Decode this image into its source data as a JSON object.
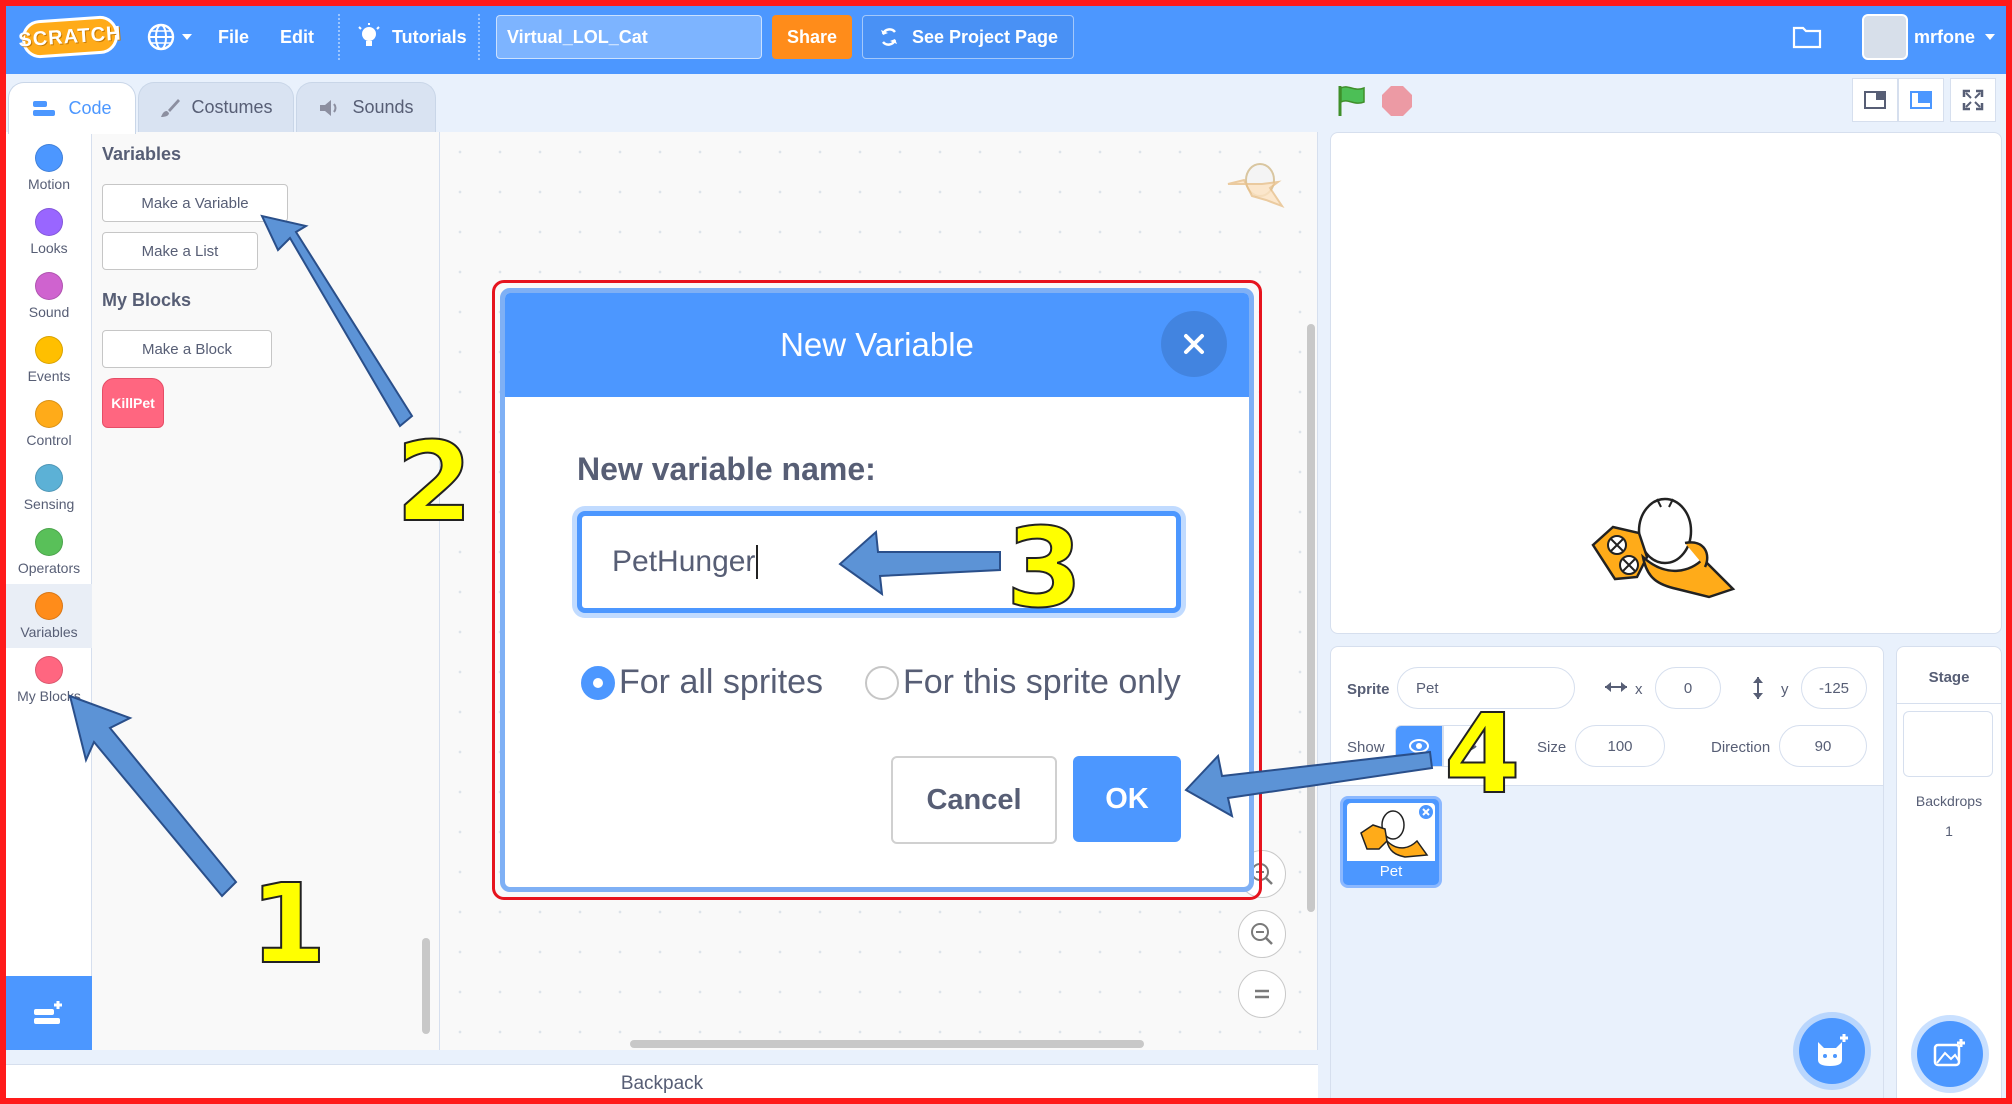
{
  "menubar": {
    "logo_text": "SCRATCH",
    "file": "File",
    "edit": "Edit",
    "tutorials": "Tutorials",
    "project_title": "Virtual_LOL_Cat",
    "share": "Share",
    "see_project": "See Project Page",
    "username": "mrfone"
  },
  "tabs": {
    "code": "Code",
    "costumes": "Costumes",
    "sounds": "Sounds"
  },
  "categories": [
    {
      "label": "Motion",
      "color": "#4c97ff"
    },
    {
      "label": "Looks",
      "color": "#9966ff"
    },
    {
      "label": "Sound",
      "color": "#cf63cf"
    },
    {
      "label": "Events",
      "color": "#ffbf00"
    },
    {
      "label": "Control",
      "color": "#ffab19"
    },
    {
      "label": "Sensing",
      "color": "#5cb1d6"
    },
    {
      "label": "Operators",
      "color": "#59c059"
    },
    {
      "label": "Variables",
      "color": "#ff8c1a"
    },
    {
      "label": "My Blocks",
      "color": "#ff6680"
    }
  ],
  "palette": {
    "variables_heading": "Variables",
    "make_variable": "Make a Variable",
    "make_list": "Make a List",
    "myblocks_heading": "My Blocks",
    "make_block": "Make a Block",
    "custom_block": "KillPet"
  },
  "backpack": "Backpack",
  "sprite_info": {
    "sprite_label": "Sprite",
    "sprite_name": "Pet",
    "x_label": "x",
    "x_value": "0",
    "y_label": "y",
    "y_value": "-125",
    "show_label": "Show",
    "size_label": "Size",
    "size_value": "100",
    "direction_label": "Direction",
    "direction_value": "90"
  },
  "sprites": [
    {
      "name": "Pet"
    }
  ],
  "stage_panel": {
    "title": "Stage",
    "backdrops_label": "Backdrops",
    "backdrops_count": "1"
  },
  "modal": {
    "title": "New Variable",
    "name_label": "New variable name:",
    "name_value": "PetHunger",
    "radio_all": "For all sprites",
    "radio_this": "For this sprite only",
    "selected_scope": "all",
    "cancel": "Cancel",
    "ok": "OK"
  },
  "annotations": {
    "step1": "1",
    "step2": "2",
    "step3": "3",
    "step4": "4"
  },
  "colors": {
    "accent": "#4c97ff",
    "share": "#ff8c1a",
    "annotation": "#ffff00",
    "highlight": "#e6141e"
  }
}
